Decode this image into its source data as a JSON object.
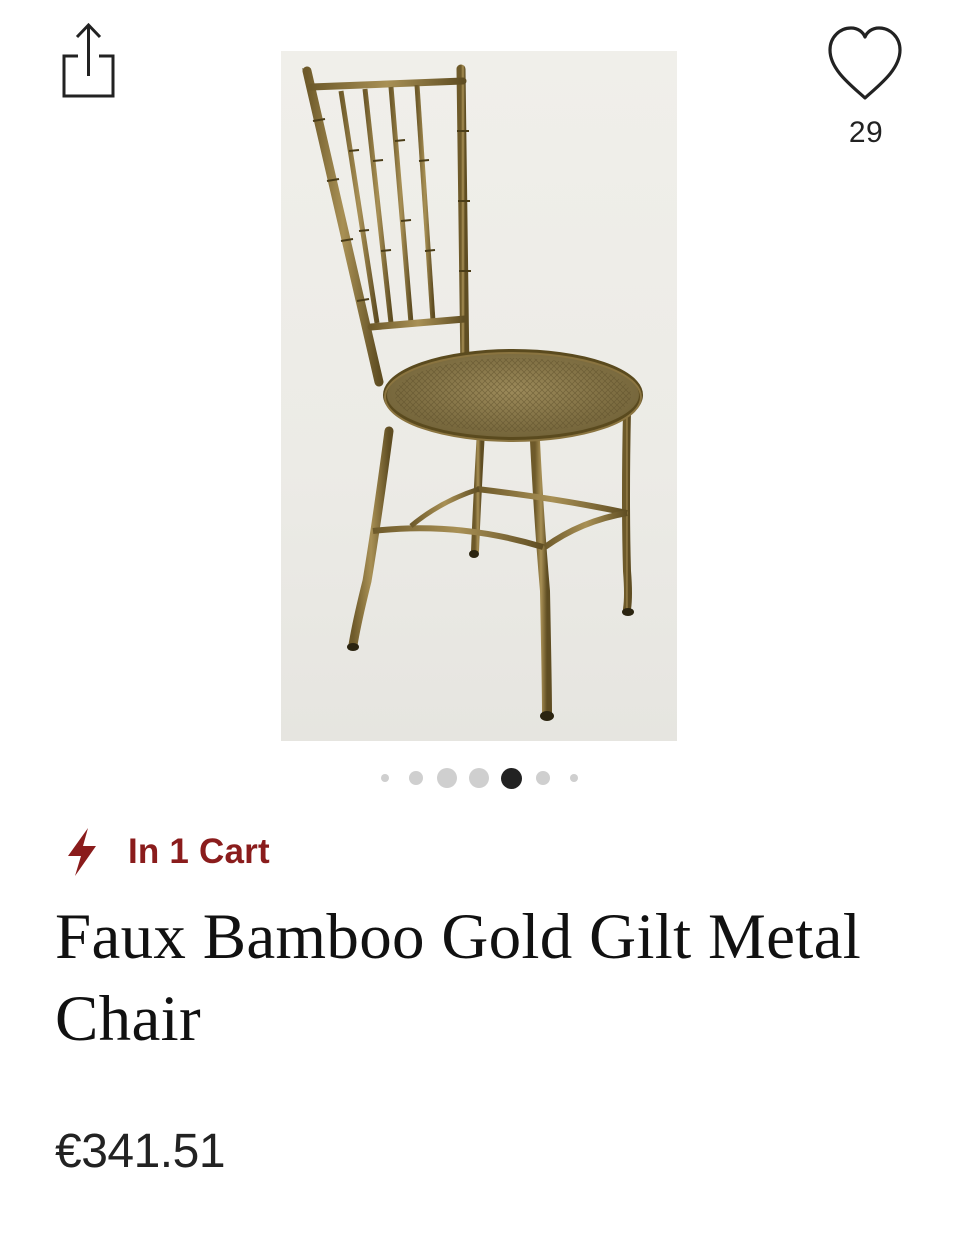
{
  "header": {
    "share_icon": "share-icon",
    "favorite_icon": "heart-icon",
    "favorite_count": "29"
  },
  "gallery": {
    "image_subject": "faux bamboo gilt metal chair",
    "dots": [
      {
        "size": "xs",
        "active": false
      },
      {
        "size": "sm",
        "active": false
      },
      {
        "size": "md",
        "active": false
      },
      {
        "size": "md",
        "active": false
      },
      {
        "size": "lg",
        "active": true
      },
      {
        "size": "sm",
        "active": false
      },
      {
        "size": "xs",
        "active": false
      }
    ],
    "active_index": 4,
    "total": 7
  },
  "product": {
    "cart_icon": "lightning-bolt-icon",
    "cart_status": "In 1 Cart",
    "title": "Faux Bamboo Gold Gilt Metal Chair",
    "price": "€341.51"
  },
  "colors": {
    "cart_status": "#8a1c1c",
    "text": "#111111",
    "dot_inactive": "#cfcfcf",
    "dot_active": "#222222"
  }
}
